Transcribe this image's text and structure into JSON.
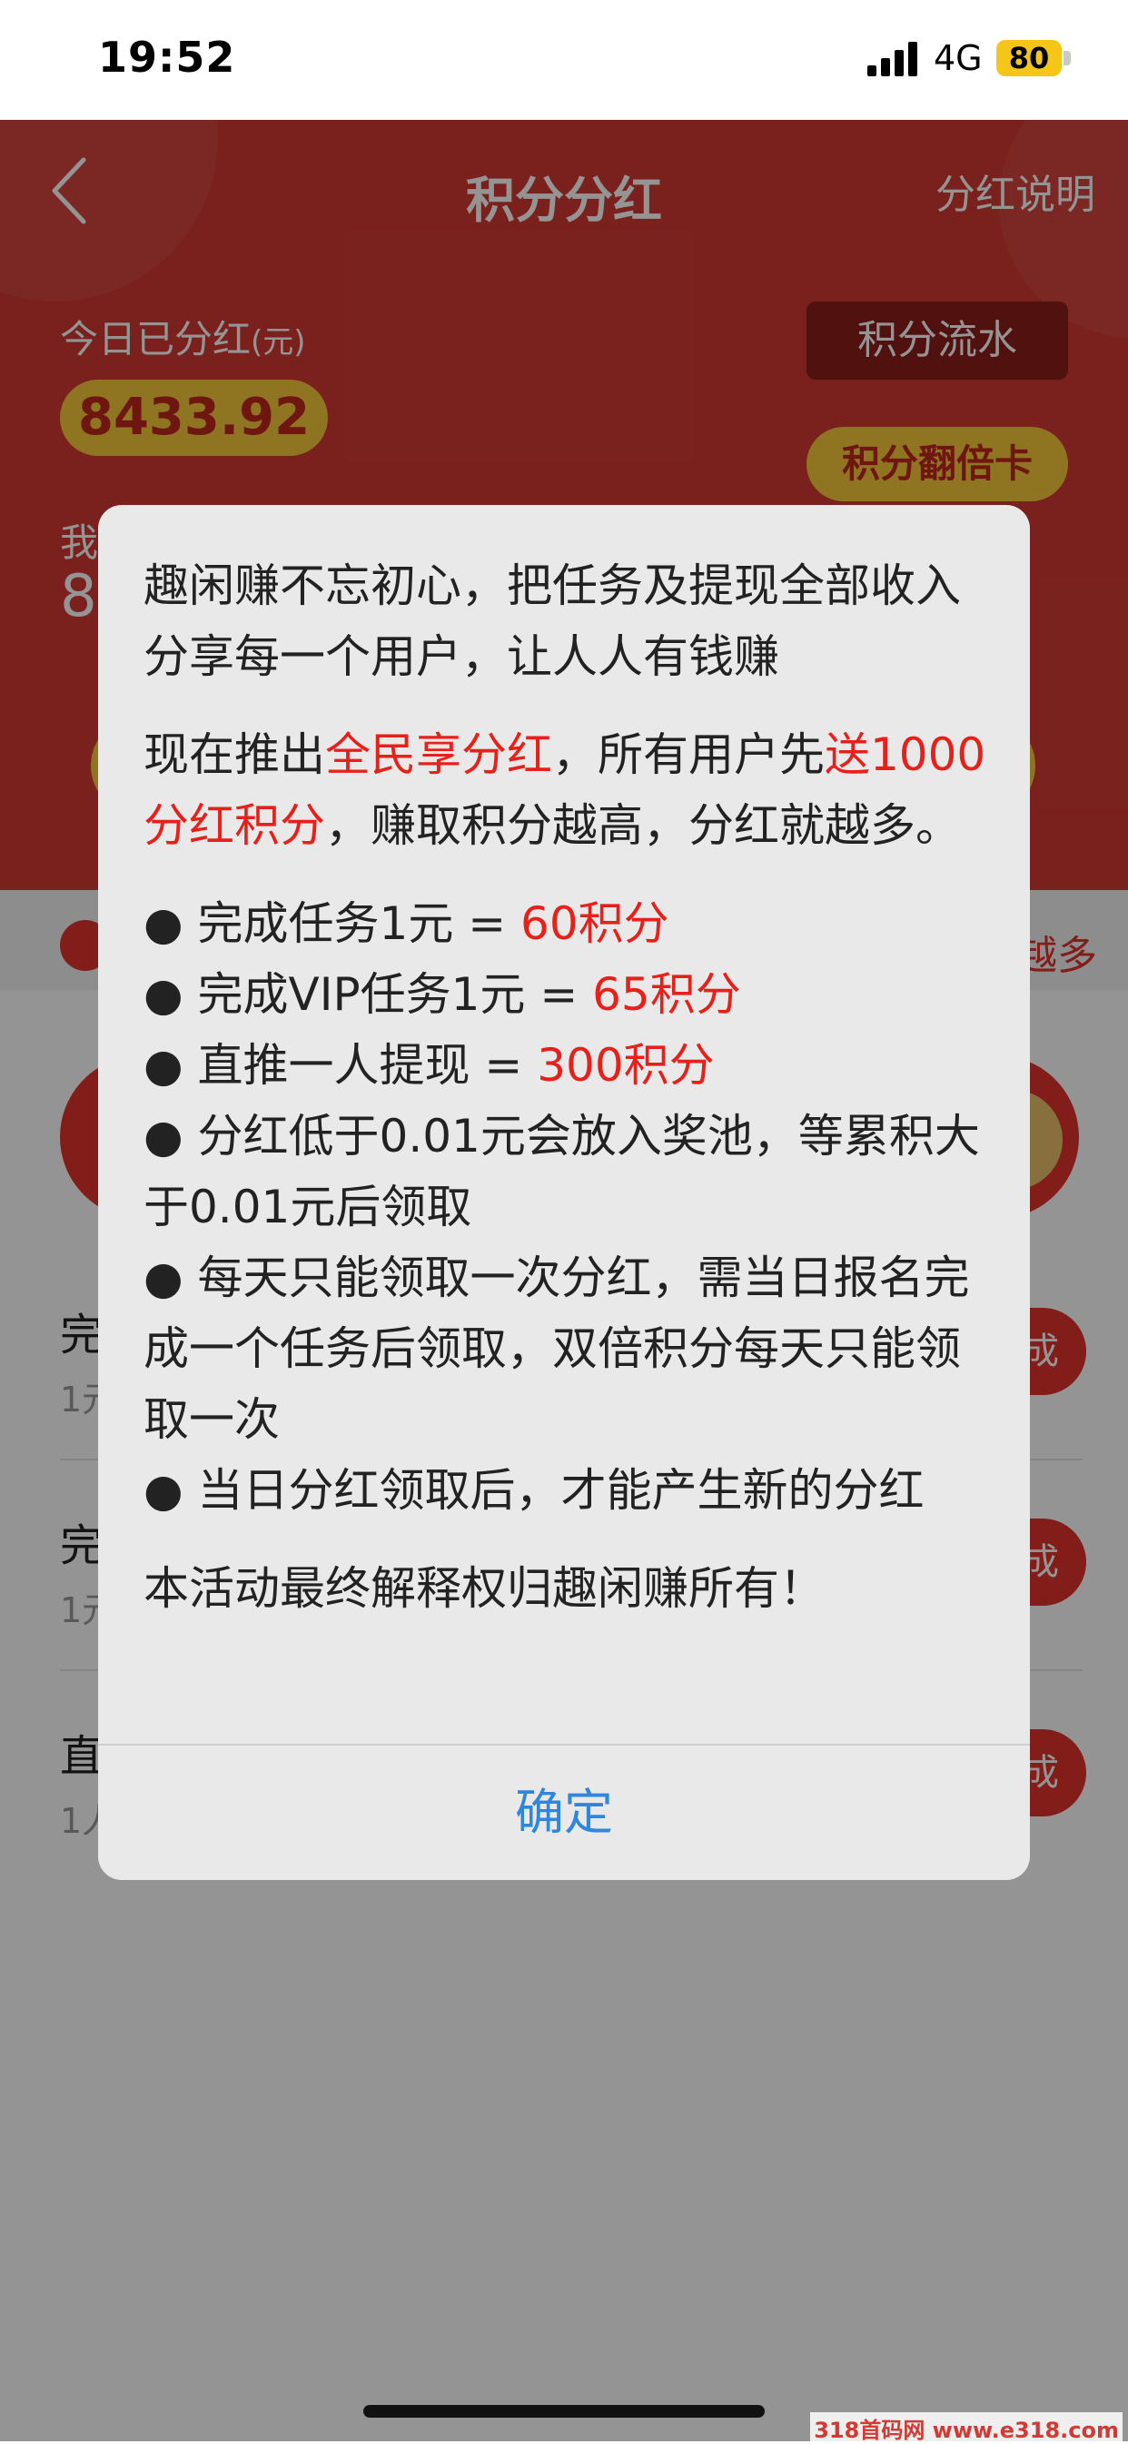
{
  "status_bar": {
    "time": "19:52",
    "network": "4G",
    "battery": "80"
  },
  "nav": {
    "title": "积分分红",
    "right_link": "分红说明"
  },
  "header": {
    "today_label": "今日已分红",
    "today_unit": "(元)",
    "today_amount": "8433.92",
    "flow_button": "积分流水",
    "double_button": "积分翻倍卡",
    "mine_label": "我",
    "mine_value": "8"
  },
  "notice": {
    "text_tail": "越多"
  },
  "tasks": [
    {
      "title": "完",
      "sub": "1元",
      "button": "成"
    },
    {
      "title": "完",
      "sub": "1元",
      "button": "成"
    },
    {
      "title": "直",
      "sub": "1人",
      "button": "成"
    }
  ],
  "modal": {
    "intro": "趣闲赚不忘初心，把任务及提现全部收入分享每一个用户，让人人有钱赚",
    "p2_pre": "现在推出",
    "p2_hl1": "全民享分红",
    "p2_mid": "，所有用户先",
    "p2_hl2": "送1000分红积分",
    "p2_post": "，赚取积分越高，分红就越多。",
    "r1_pre": "● 完成任务1元 = ",
    "r1_hl": "60积分",
    "r2_pre": "● 完成VIP任务1元 = ",
    "r2_hl": "65积分",
    "r3_pre": "● 直推一人提现 = ",
    "r3_hl": "300积分",
    "r4": "● 分红低于0.01元会放入奖池，等累积大于0.01元后领取",
    "r5": "● 每天只能领取一次分红，需当日报名完成一个任务后领取，双倍积分每天只能领取一次",
    "r6": "● 当日分红领取后，才能产生新的分红",
    "footer": "本活动最终解释权归趣闲赚所有！",
    "confirm": "确定"
  },
  "watermark": "318首码网 www.e318.com",
  "colors": {
    "header_red": "#d23a33",
    "gold": "#f6c83c",
    "highlight_red": "#e8201a",
    "link_blue": "#2e86de"
  }
}
